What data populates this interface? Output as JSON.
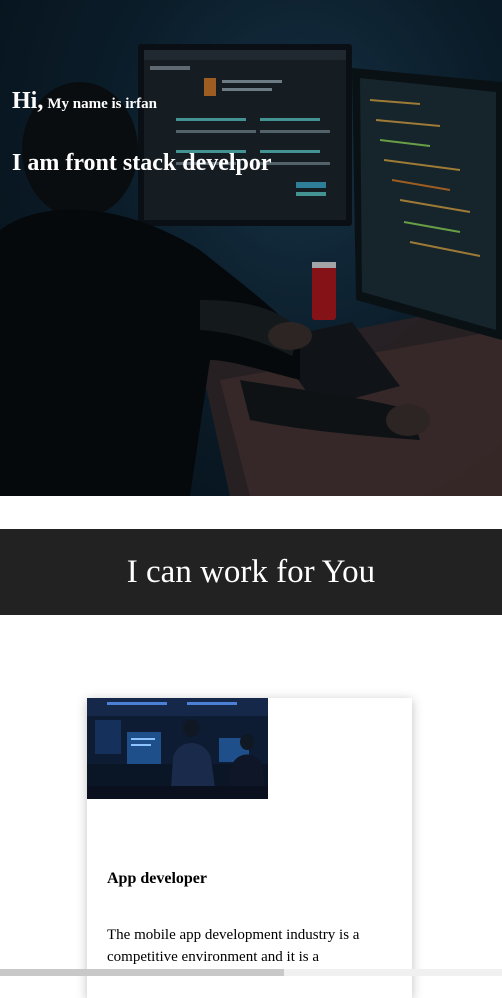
{
  "hero": {
    "greeting": "Hi,",
    "name_line": "My name is irfan",
    "role": "I am front stack develpor"
  },
  "services": {
    "heading": "I can work for You",
    "card": {
      "title": "App developer",
      "description": "The mobile app development industry is a competitive environment and it is a"
    }
  },
  "colors": {
    "hero_bg": "#0e2434",
    "header_bg": "#222222",
    "accent_screen": "#2b5f7a"
  },
  "scrollbar": {
    "horizontal_position": 0,
    "visible_fraction": 0.57
  }
}
